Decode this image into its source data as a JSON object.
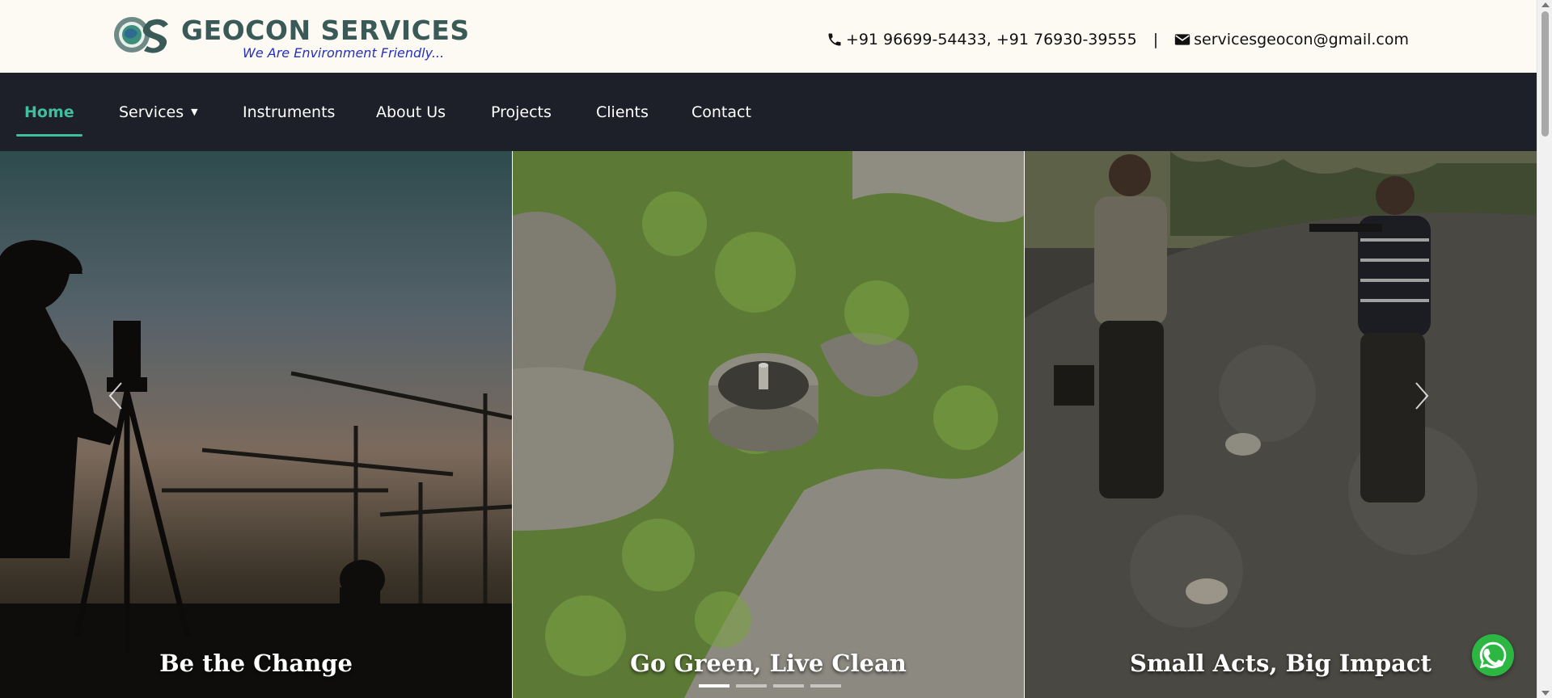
{
  "header": {
    "brand": "GEOCON SERVICES",
    "tagline": "We Are Environment Friendly...",
    "logo_letters": "GS",
    "phone": "+91 96699-54433, +91 76930-39555",
    "separator": "|",
    "email": "servicesgeocon@gmail.com"
  },
  "nav": {
    "items": [
      {
        "label": "Home",
        "active": true
      },
      {
        "label": "Services",
        "dropdown": true
      },
      {
        "label": "Instruments"
      },
      {
        "label": "About Us"
      },
      {
        "label": "Projects"
      },
      {
        "label": "Clients"
      },
      {
        "label": "Contact"
      }
    ],
    "caret": "▼"
  },
  "slider": {
    "captions": [
      "Be the Change",
      "Go Green, Live Clean",
      "Small Acts, Big Impact"
    ],
    "dot_count": 4,
    "active_dot": 0
  },
  "colors": {
    "accent": "#3fbf9f",
    "nav_bg": "#1d2028",
    "brand": "#3a5a58",
    "tagline": "#2430c0",
    "whatsapp": "#2bb741"
  },
  "icons": [
    "phone-icon",
    "envelope-icon",
    "chevron-left-icon",
    "chevron-right-icon",
    "whatsapp-icon"
  ]
}
